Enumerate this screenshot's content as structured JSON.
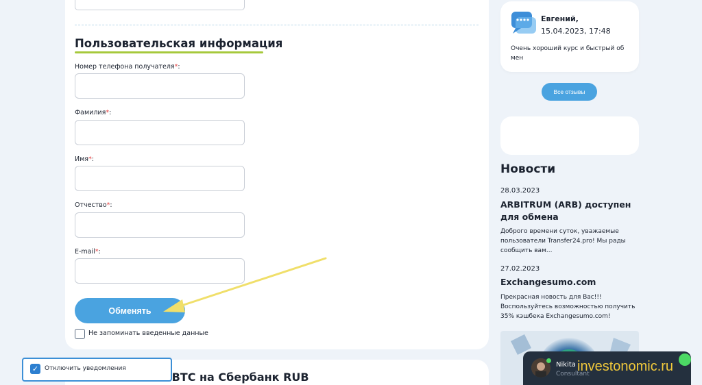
{
  "form": {
    "section_title": "Пользовательская информация",
    "fields": [
      {
        "label": "Номер телефона получателя",
        "required_mark": "*",
        "value": ""
      },
      {
        "label": "Фамилия",
        "required_mark": "*",
        "value": ""
      },
      {
        "label": "Имя",
        "required_mark": "*",
        "value": ""
      },
      {
        "label": "Отчество",
        "required_mark": "*",
        "value": ""
      },
      {
        "label": "E-mail",
        "required_mark": "*",
        "value": ""
      }
    ],
    "submit_label": "Обменять",
    "remember_label": "Не запоминать введенные данные",
    "remember_checked": false
  },
  "next_section_title": "Обмен Bitcoin BTC на Сбербанк RUB",
  "notifications": {
    "label": "Отключить уведомления",
    "checked": true
  },
  "review": {
    "name": "Евгений,",
    "date": "15.04.2023, 17:48",
    "text": "Очень хороший курс и быстрый об мен",
    "all_reviews_label": "Все отзывы"
  },
  "news": {
    "heading": "Новости",
    "items": [
      {
        "date": "28.03.2023",
        "title": "ARBITRUM (ARB) доступен для обмена",
        "text": "Доброго времени суток, уважаемые пользователи Transfer24.pro! Мы рады сообщить вам..."
      },
      {
        "date": "27.02.2023",
        "title": "Exchangesumo.com",
        "text": "Прекрасная новость для Вас!!! Воспользуйтесь возможностью получить 35% кэшбека Exchangesumo.com!"
      }
    ]
  },
  "chat": {
    "name": "Nikita",
    "role": "Consultant"
  },
  "watermark": "investonomic.ru",
  "colors": {
    "accent": "#4aa3e0",
    "underline": "#a6c93c",
    "required": "#e33e3e",
    "arrow": "#f0df6a"
  }
}
